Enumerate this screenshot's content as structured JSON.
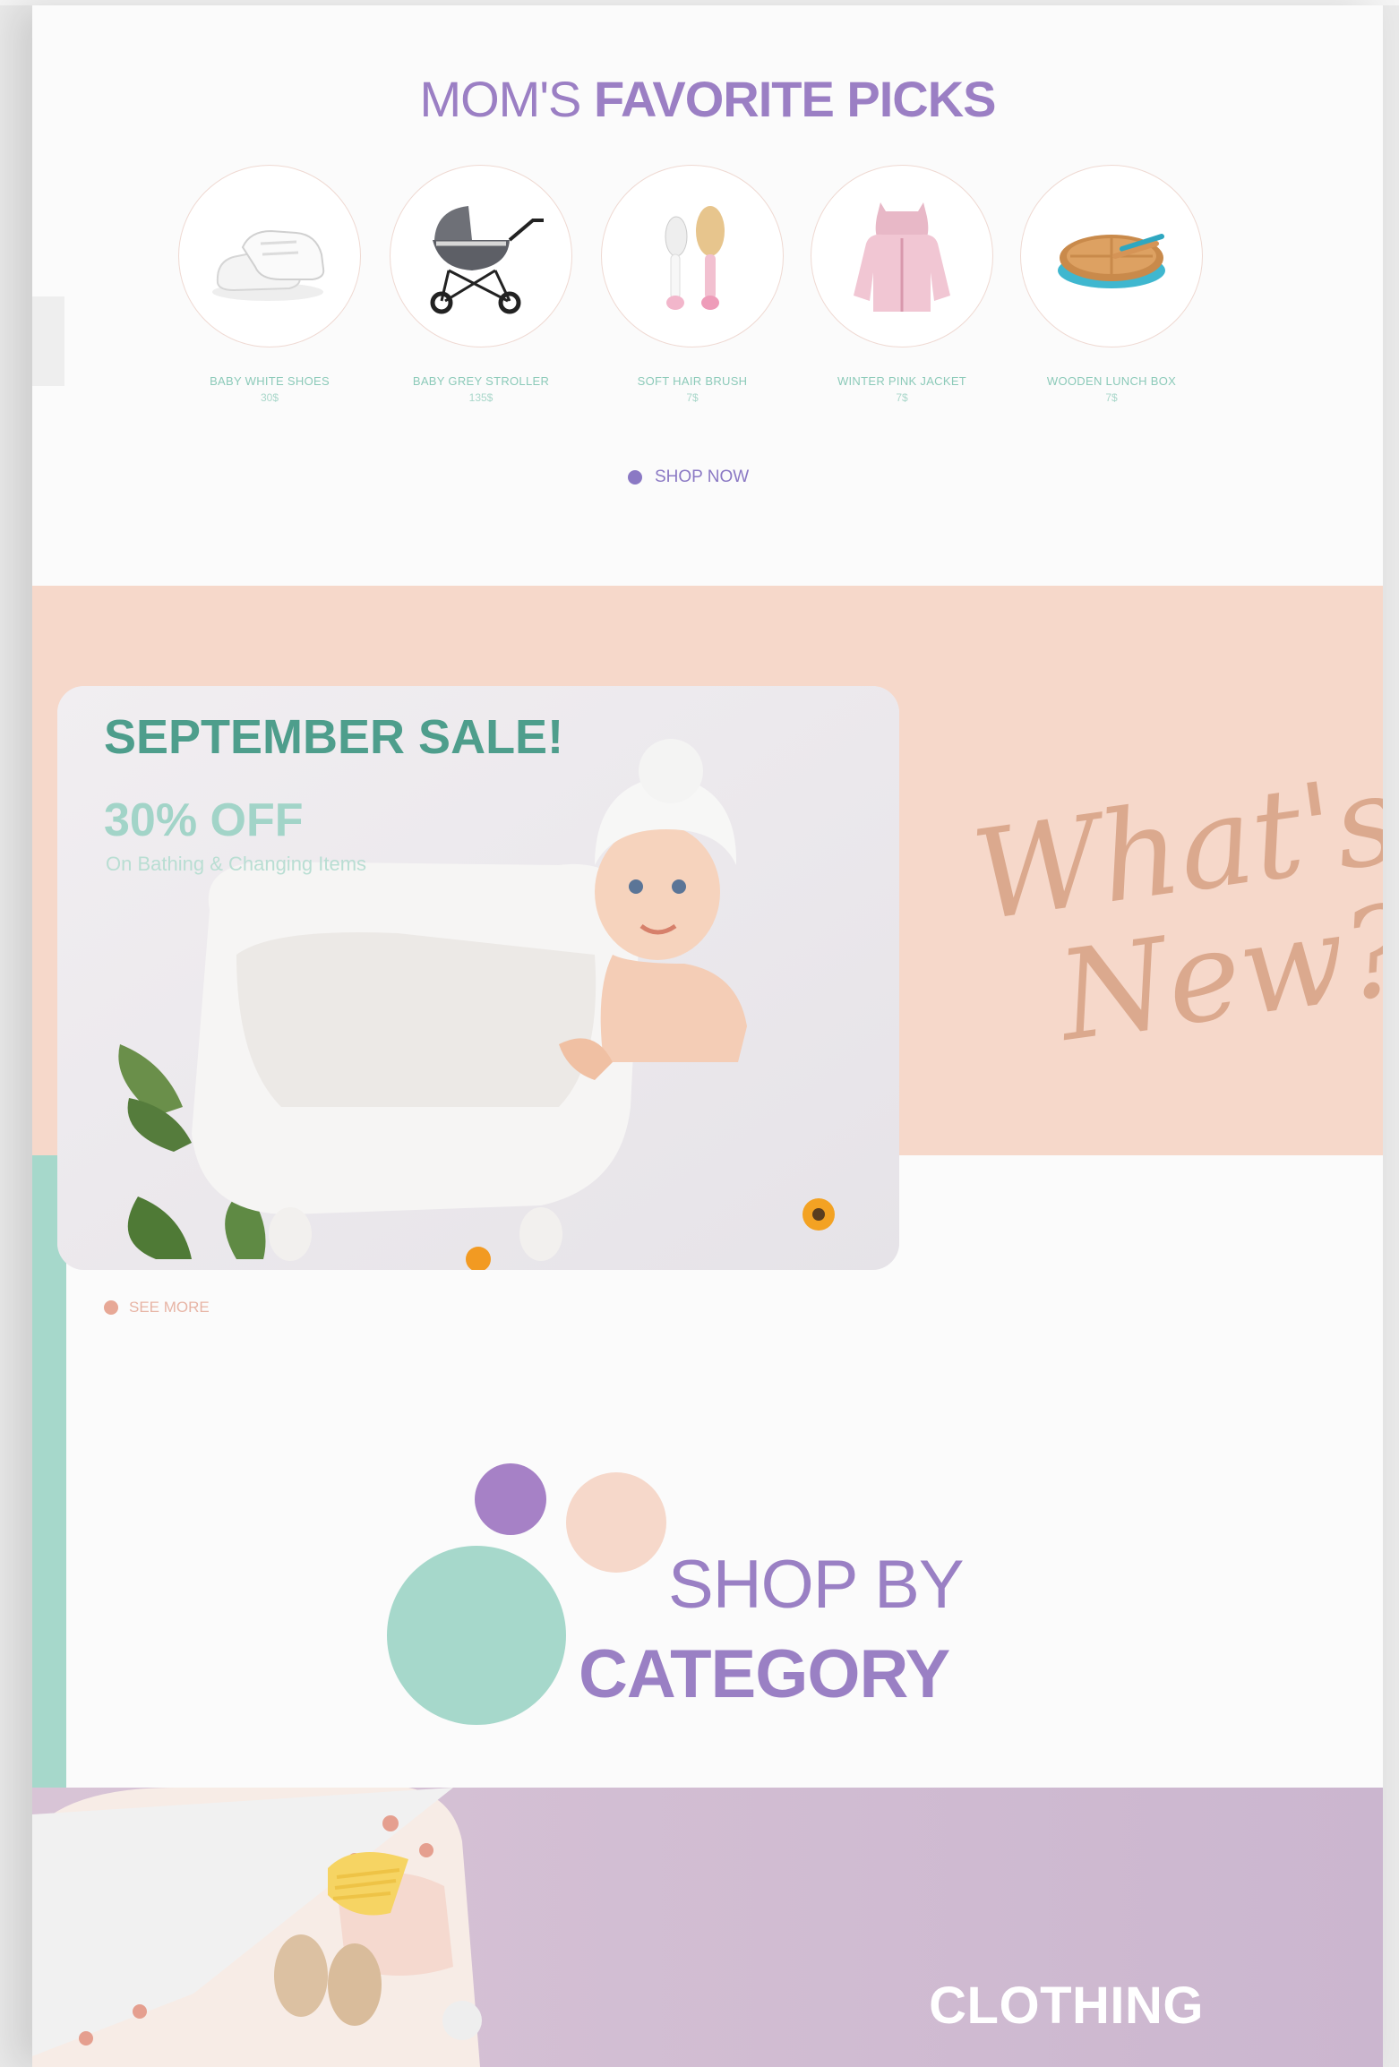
{
  "favorites": {
    "title_light": "MOM'S",
    "title_bold": "FAVORITE PICKS",
    "items": [
      {
        "name": "BABY WHITE SHOES",
        "price": "30$",
        "icon": "baby-shoes-icon"
      },
      {
        "name": "BABY GREY STROLLER",
        "price": "135$",
        "icon": "stroller-icon"
      },
      {
        "name": "SOFT HAIR BRUSH",
        "price": "7$",
        "icon": "hair-brush-icon"
      },
      {
        "name": "WINTER PINK JACKET",
        "price": "7$",
        "icon": "pink-jacket-icon"
      },
      {
        "name": "WOODEN LUNCH BOX",
        "price": "7$",
        "icon": "lunch-box-icon"
      }
    ],
    "cta_label": "SHOP NOW"
  },
  "sale": {
    "title": "SEPTEMBER SALE!",
    "discount": "30% OFF",
    "subtitle": "On Bathing & Changing Items",
    "cta_label": "SEE MORE"
  },
  "whats_new": {
    "line1": "What's",
    "line2": "New?"
  },
  "category": {
    "line1": "SHOP BY",
    "line2": "CATEGORY"
  },
  "clothing": {
    "label": "CLOTHING"
  },
  "colors": {
    "purple": "#9b7fc4",
    "teal": "#a6d8cb",
    "peach": "#f6d8ca",
    "lilac": "#d3bfd4"
  }
}
